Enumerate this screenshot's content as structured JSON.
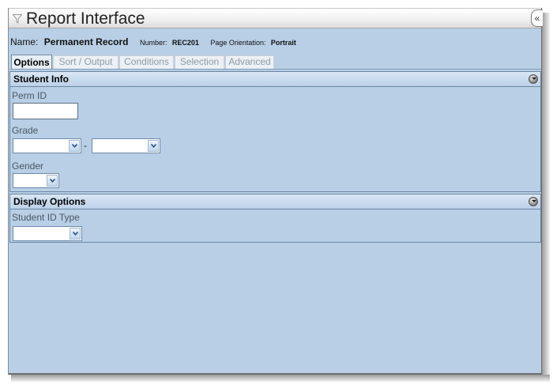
{
  "window": {
    "title": "Report Interface",
    "collapse_button": "«"
  },
  "report": {
    "name_label": "Name:",
    "name_value": "Permanent Record",
    "number_label": "Number:",
    "number_value": "REC201",
    "orientation_label": "Page Orientation:",
    "orientation_value": "Portrait"
  },
  "tabs": [
    {
      "label": "Options",
      "active": true
    },
    {
      "label": "Sort / Output",
      "active": false
    },
    {
      "label": "Conditions",
      "active": false
    },
    {
      "label": "Selection",
      "active": false
    },
    {
      "label": "Advanced",
      "active": false
    }
  ],
  "student_info": {
    "title": "Student Info",
    "perm_id": {
      "label": "Perm ID",
      "value": ""
    },
    "grade": {
      "label": "Grade",
      "from": "",
      "separator": "-",
      "to": ""
    },
    "gender": {
      "label": "Gender",
      "value": ""
    }
  },
  "display_options": {
    "title": "Display Options",
    "student_id_type": {
      "label": "Student ID Type",
      "value": ""
    }
  },
  "icons": {
    "title_icon": "filter-icon",
    "section_toggle": "collapse-circle-icon",
    "dropdown_arrow": "chevron-down-icon"
  },
  "colors": {
    "panel_background": "#b8cfe6",
    "section_border": "#6b87a4",
    "dropdown_accent": "#1f4f8a"
  }
}
